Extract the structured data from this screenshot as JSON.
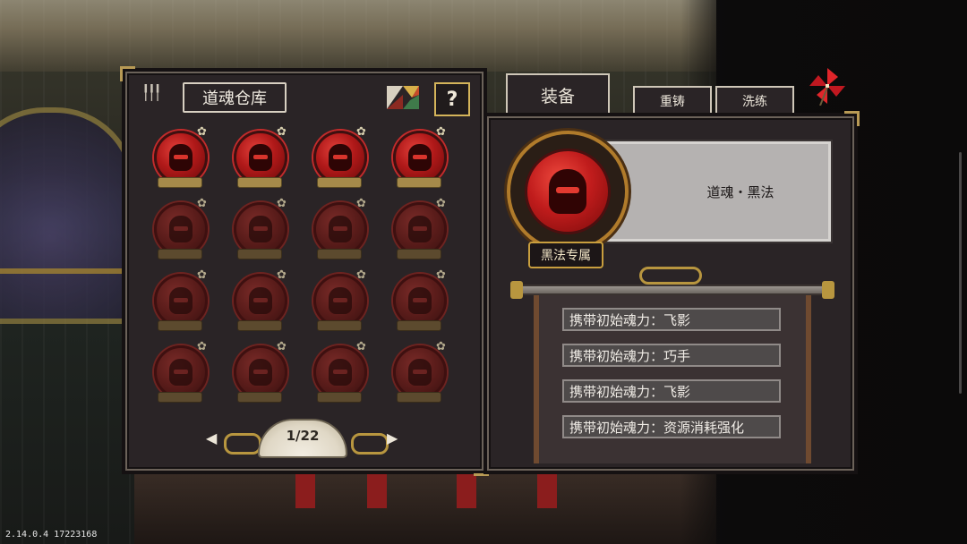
{
  "warehouse": {
    "title": "道魂仓库",
    "help_label": "?",
    "star_glyph": "✿",
    "slots": [
      {
        "state": "bright"
      },
      {
        "state": "bright"
      },
      {
        "state": "bright"
      },
      {
        "state": "bright"
      },
      {
        "state": "dim"
      },
      {
        "state": "dim"
      },
      {
        "state": "dim"
      },
      {
        "state": "dim"
      },
      {
        "state": "dim"
      },
      {
        "state": "dim"
      },
      {
        "state": "dim"
      },
      {
        "state": "dim"
      },
      {
        "state": "dim"
      },
      {
        "state": "dim"
      },
      {
        "state": "dim"
      },
      {
        "state": "dim"
      }
    ],
    "pager": {
      "text": "1/22",
      "prev": "◀",
      "next": "▶"
    }
  },
  "tabs": {
    "equip": "装备",
    "recast": "重铸",
    "refine": "洗练"
  },
  "equipped": {
    "name": "道魂・黑法",
    "exclusive_label": "黑法专属",
    "traits": [
      "携带初始魂力：飞影",
      "携带初始魂力：巧手",
      "携带初始魂力：飞影",
      "携带初始魂力：资源消耗强化"
    ]
  },
  "colors": {
    "accent_gold": "#c89e3e",
    "soul_red": "#c01c1c",
    "panel_bg": "#2a2426"
  },
  "footer": {
    "version": "2.14.0.4 17223168"
  }
}
